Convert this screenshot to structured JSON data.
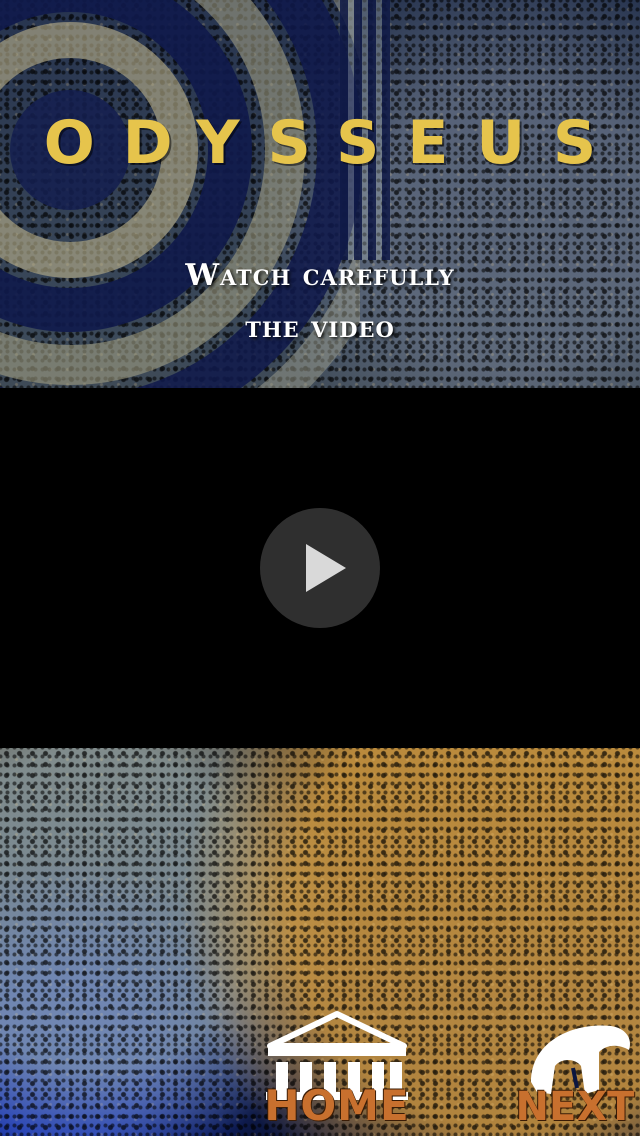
{
  "app": {
    "title": "ODYSSEUS"
  },
  "instructions": {
    "line1": "Watch carefully",
    "line2": "the video"
  },
  "video": {
    "play_icon": "play-icon"
  },
  "bottom_nav": {
    "home": {
      "label": "HOME",
      "icon": "temple-icon"
    },
    "next": {
      "label": "NEXT",
      "icon": "spartan-helmet-icon"
    }
  },
  "colors": {
    "title": "#e6c44c",
    "nav_label": "#c8702e",
    "video_bg": "#000000"
  }
}
